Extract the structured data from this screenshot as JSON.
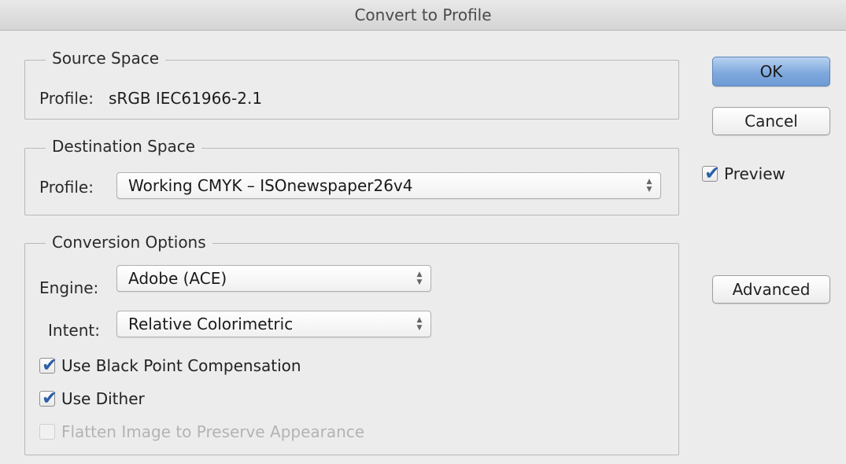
{
  "window": {
    "title": "Convert to Profile"
  },
  "source": {
    "legend": "Source Space",
    "profile_label": "Profile:",
    "profile_value": "sRGB IEC61966-2.1"
  },
  "destination": {
    "legend": "Destination Space",
    "profile_label": "Profile:",
    "profile_selected": "Working CMYK – ISOnewspaper26v4"
  },
  "conversion": {
    "legend": "Conversion Options",
    "engine_label": "Engine:",
    "engine_selected": "Adobe (ACE)",
    "intent_label": "Intent:",
    "intent_selected": "Relative Colorimetric",
    "black_point": {
      "label": "Use Black Point Compensation",
      "checked": true,
      "enabled": true
    },
    "dither": {
      "label": "Use Dither",
      "checked": true,
      "enabled": true
    },
    "flatten": {
      "label": "Flatten Image to Preserve Appearance",
      "checked": false,
      "enabled": false
    }
  },
  "buttons": {
    "ok": "OK",
    "cancel": "Cancel",
    "advanced": "Advanced"
  },
  "preview": {
    "label": "Preview",
    "checked": true
  },
  "icons": {
    "checkmark": "✔",
    "stepper": "updown-arrows-icon"
  },
  "colors": {
    "default_button": "#7fa9dd",
    "checkmark": "#2d5fa8",
    "disabled_text": "#b3b3b3"
  }
}
